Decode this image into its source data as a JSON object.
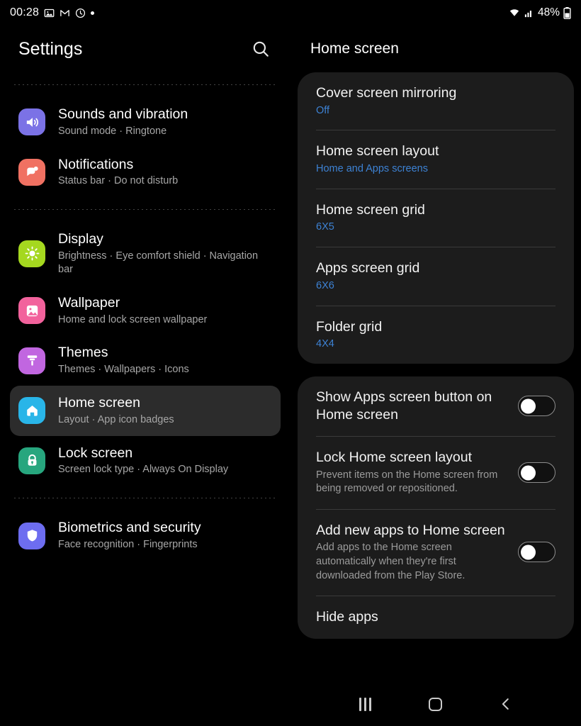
{
  "status_bar": {
    "time": "00:28",
    "left_icons": [
      "gallery-icon",
      "gmail-icon",
      "clock-icon",
      "dot-icon"
    ],
    "battery_percent": "48%",
    "right_icons": [
      "wifi-icon",
      "cellular-signal-icon",
      "battery-icon"
    ]
  },
  "sidebar": {
    "title": "Settings",
    "search_icon": "search-icon",
    "items": [
      {
        "label": "Sounds and vibration",
        "sub": "Sound mode  ·  Ringtone",
        "icon": "speaker-icon",
        "color": "#7b72e6",
        "selected": false
      },
      {
        "label": "Notifications",
        "sub": "Status bar  ·  Do not disturb",
        "icon": "notification-icon",
        "color": "#f07162",
        "selected": false
      },
      {
        "label": "Display",
        "sub": "Brightness  ·  Eye comfort shield  ·  Navigation bar",
        "icon": "brightness-icon",
        "color": "#a5d81f",
        "selected": false
      },
      {
        "label": "Wallpaper",
        "sub": "Home and lock screen wallpaper",
        "icon": "image-icon",
        "color": "#f2629c",
        "selected": false
      },
      {
        "label": "Themes",
        "sub": "Themes  ·  Wallpapers  ·  Icons",
        "icon": "paint-roller-icon",
        "color": "#c166e0",
        "selected": false
      },
      {
        "label": "Home screen",
        "sub": "Layout  ·  App icon badges",
        "icon": "home-icon",
        "color": "#29b5e8",
        "selected": true
      },
      {
        "label": "Lock screen",
        "sub": "Screen lock type  ·  Always On Display",
        "icon": "lock-icon",
        "color": "#27a67e",
        "selected": false
      },
      {
        "label": "Biometrics and security",
        "sub": "Face recognition  ·  Fingerprints",
        "icon": "shield-icon",
        "color": "#6d6df0",
        "selected": false
      }
    ]
  },
  "detail": {
    "title": "Home screen",
    "card_one": [
      {
        "title": "Cover screen mirroring",
        "value": "Off"
      },
      {
        "title": "Home screen layout",
        "value": "Home and Apps screens"
      },
      {
        "title": "Home screen grid",
        "value": "6X5"
      },
      {
        "title": "Apps screen grid",
        "value": "6X6"
      },
      {
        "title": "Folder grid",
        "value": "4X4"
      }
    ],
    "card_two": [
      {
        "title": "Show Apps screen button on Home screen",
        "desc": "",
        "toggle": "off"
      },
      {
        "title": "Lock Home screen layout",
        "desc": "Prevent items on the Home screen from being removed or repositioned.",
        "toggle": "off"
      },
      {
        "title": "Add new apps to Home screen",
        "desc": "Add apps to the Home screen automatically when they're first downloaded from the Play Store.",
        "toggle": "off"
      },
      {
        "title": "Hide apps",
        "desc": "",
        "toggle": "none"
      }
    ]
  },
  "nav_bar": {
    "recents_label": "recents-button",
    "home_label": "home-button",
    "back_label": "back-button"
  },
  "colors": {
    "accent_blue": "#3d82d4",
    "card_bg": "#1c1c1c",
    "selected_bg": "#2c2c2c"
  }
}
